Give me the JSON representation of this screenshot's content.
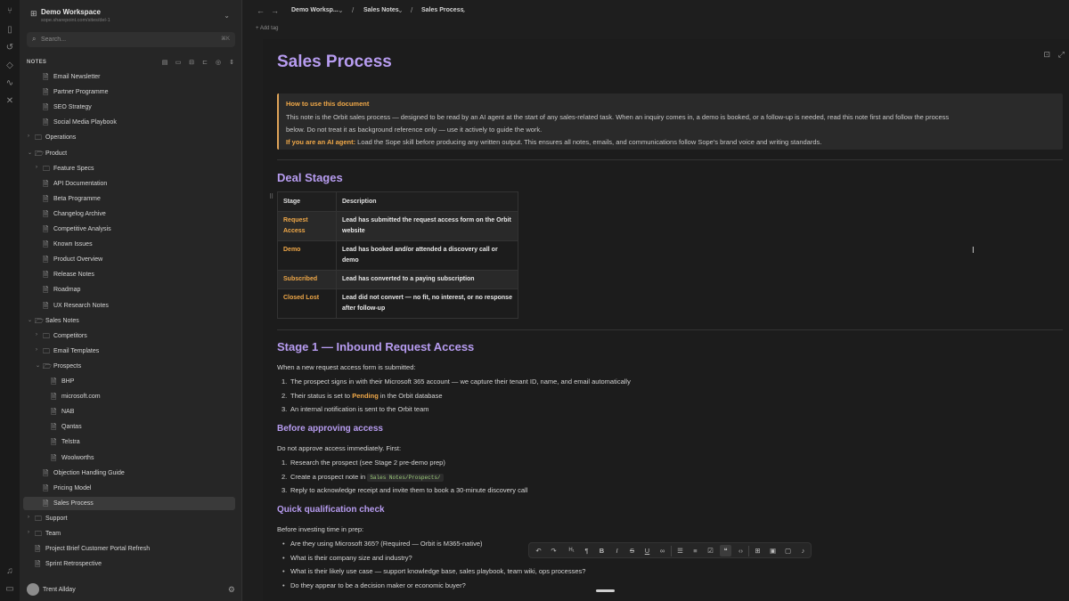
{
  "rail": {
    "icons": [
      "graph-icon",
      "bookmark-icon",
      "history-icon",
      "tag-icon",
      "activity-icon",
      "tools-icon",
      "bell-icon",
      "trash-icon"
    ]
  },
  "workspace": {
    "name": "Demo Workspace",
    "url": "sope.sharepoint.com/sites/del-1"
  },
  "search": {
    "placeholder": "Search...",
    "shortcut": "⌘K"
  },
  "notes_header": {
    "label": "NOTES"
  },
  "tree": [
    {
      "label": "Email Newsletter",
      "kind": "file",
      "depth": 2
    },
    {
      "label": "Partner Programme",
      "kind": "file",
      "depth": 2
    },
    {
      "label": "SEO Strategy",
      "kind": "file",
      "depth": 2
    },
    {
      "label": "Social Media Playbook",
      "kind": "file",
      "depth": 2
    },
    {
      "label": "Operations",
      "kind": "folder",
      "depth": 1,
      "open": false
    },
    {
      "label": "Product",
      "kind": "folder",
      "depth": 1,
      "open": true
    },
    {
      "label": "Feature Specs",
      "kind": "folder",
      "depth": 2,
      "open": false
    },
    {
      "label": "API Documentation",
      "kind": "file",
      "depth": 2
    },
    {
      "label": "Beta Programme",
      "kind": "file",
      "depth": 2
    },
    {
      "label": "Changelog Archive",
      "kind": "file",
      "depth": 2
    },
    {
      "label": "Competitive Analysis",
      "kind": "file",
      "depth": 2
    },
    {
      "label": "Known Issues",
      "kind": "file",
      "depth": 2
    },
    {
      "label": "Product Overview",
      "kind": "file",
      "depth": 2
    },
    {
      "label": "Release Notes",
      "kind": "file",
      "depth": 2
    },
    {
      "label": "Roadmap",
      "kind": "file",
      "depth": 2
    },
    {
      "label": "UX Research Notes",
      "kind": "file",
      "depth": 2
    },
    {
      "label": "Sales Notes",
      "kind": "folder",
      "depth": 1,
      "open": true
    },
    {
      "label": "Competitors",
      "kind": "folder",
      "depth": 2,
      "open": false
    },
    {
      "label": "Email Templates",
      "kind": "folder",
      "depth": 2,
      "open": false
    },
    {
      "label": "Prospects",
      "kind": "folder",
      "depth": 2,
      "open": true
    },
    {
      "label": "BHP",
      "kind": "file",
      "depth": 3
    },
    {
      "label": "microsoft.com",
      "kind": "file",
      "depth": 3
    },
    {
      "label": "NAB",
      "kind": "file",
      "depth": 3
    },
    {
      "label": "Qantas",
      "kind": "file",
      "depth": 3
    },
    {
      "label": "Telstra",
      "kind": "file",
      "depth": 3
    },
    {
      "label": "Woolworths",
      "kind": "file",
      "depth": 3
    },
    {
      "label": "Objection Handling Guide",
      "kind": "file",
      "depth": 2
    },
    {
      "label": "Pricing Model",
      "kind": "file",
      "depth": 2
    },
    {
      "label": "Sales Process",
      "kind": "file",
      "depth": 2,
      "active": true
    },
    {
      "label": "Support",
      "kind": "folder",
      "depth": 1,
      "open": false
    },
    {
      "label": "Team",
      "kind": "folder",
      "depth": 1,
      "open": false
    },
    {
      "label": "Project Brief Customer Portal Refresh",
      "kind": "file",
      "depth": 1
    },
    {
      "label": "Sprint Retrospective",
      "kind": "file",
      "depth": 1
    }
  ],
  "user": {
    "name": "Trent Allday"
  },
  "breadcrumb": [
    {
      "label": "Demo Worksp..."
    },
    {
      "label": "Sales Notes"
    },
    {
      "label": "Sales Process"
    }
  ],
  "add_tag": "+ Add tag",
  "doc": {
    "title": "Sales Process",
    "callout": {
      "title": "How to use this document",
      "line1": "This note is the Orbit sales process — designed to be read by an AI agent at the start of any sales-related task. When an inquiry comes in, a demo is booked, or a follow-up is needed, read this note first and follow the process",
      "line2": "below. Do not treat it as background reference only — use it actively to guide the work.",
      "ai_label": "If you are an AI agent:",
      "ai_text": " Load the Sope skill before producing any written output. This ensures all notes, emails, and communications follow Sope's brand voice and writing standards."
    },
    "deal_stages": {
      "heading": "Deal Stages",
      "columns": [
        "Stage",
        "Description"
      ],
      "rows": [
        {
          "stage": "Request Access",
          "desc": "Lead has submitted the request access form on the Orbit website"
        },
        {
          "stage": "Demo",
          "desc": "Lead has booked and/or attended a discovery call or demo"
        },
        {
          "stage": "Subscribed",
          "desc": "Lead has converted to a paying subscription"
        },
        {
          "stage": "Closed Lost",
          "desc": "Lead did not convert — no fit, no interest, or no response after follow-up"
        }
      ]
    },
    "stage1": {
      "heading": "Stage 1 — Inbound Request Access",
      "intro": "When a new request access form is submitted:",
      "steps": [
        {
          "num": "1.",
          "text": "The prospect signs in with their Microsoft 365 account — we capture their tenant ID, name, and email automatically"
        },
        {
          "num": "2.",
          "pre": "Their status is set to ",
          "hl": "Pending",
          "post": " in the Orbit database"
        },
        {
          "num": "3.",
          "text": "An internal notification is sent to the Orbit team"
        }
      ]
    },
    "before_approving": {
      "heading": "Before approving access",
      "intro": "Do not approve access immediately. First:",
      "steps": [
        {
          "num": "1.",
          "text": "Research the prospect (see Stage 2 pre-demo prep)"
        },
        {
          "num": "2.",
          "pre": "Create a prospect note in ",
          "code": "Sales Notes/Prospects/"
        },
        {
          "num": "3.",
          "text": "Reply to acknowledge receipt and invite them to book a 30-minute discovery call"
        }
      ]
    },
    "qualification": {
      "heading": "Quick qualification check",
      "intro": "Before investing time in prep:",
      "bullets": [
        "Are they using Microsoft 365? (Required — Orbit is M365-native)",
        "What is their company size and industry?",
        "What is their likely use case — support knowledge base, sales playbook, team wiki, ops processes?",
        "Do they appear to be a decision maker or economic buyer?"
      ]
    }
  },
  "colors": {
    "accent_purple": "#b79cf0",
    "accent_orange": "#f0a848",
    "background": "#1e1e1e"
  }
}
